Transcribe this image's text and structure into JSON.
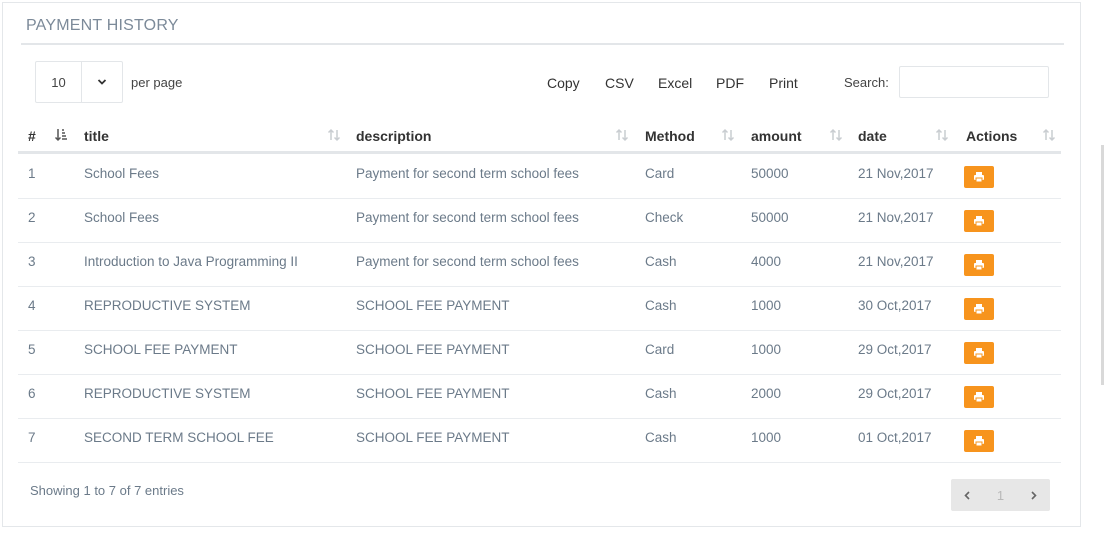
{
  "panel": {
    "title": "PAYMENT HISTORY"
  },
  "length": {
    "value": "10",
    "suffix": "per page"
  },
  "buttons": [
    "Copy",
    "CSV",
    "Excel",
    "PDF",
    "Print"
  ],
  "search": {
    "label": "Search:",
    "value": ""
  },
  "columns": [
    "#",
    "title",
    "description",
    "Method",
    "amount",
    "date",
    "Actions"
  ],
  "rows": [
    {
      "n": "1",
      "title": "School Fees",
      "description": "Payment for second term school fees",
      "method": "Card",
      "amount": "50000",
      "date": "21 Nov,2017"
    },
    {
      "n": "2",
      "title": "School Fees",
      "description": "Payment for second term school fees",
      "method": "Check",
      "amount": "50000",
      "date": "21 Nov,2017"
    },
    {
      "n": "3",
      "title": "Introduction to Java Programming II",
      "description": "Payment for second term school fees",
      "method": "Cash",
      "amount": "4000",
      "date": "21 Nov,2017"
    },
    {
      "n": "4",
      "title": "REPRODUCTIVE SYSTEM",
      "description": "SCHOOL FEE PAYMENT",
      "method": "Cash",
      "amount": "1000",
      "date": "30 Oct,2017"
    },
    {
      "n": "5",
      "title": "SCHOOL FEE PAYMENT",
      "description": "SCHOOL FEE PAYMENT",
      "method": "Card",
      "amount": "1000",
      "date": "29 Oct,2017"
    },
    {
      "n": "6",
      "title": "REPRODUCTIVE SYSTEM",
      "description": "SCHOOL FEE PAYMENT",
      "method": "Cash",
      "amount": "2000",
      "date": "29 Oct,2017"
    },
    {
      "n": "7",
      "title": "SECOND TERM SCHOOL FEE",
      "description": "SCHOOL FEE PAYMENT",
      "method": "Cash",
      "amount": "1000",
      "date": "01 Oct,2017"
    }
  ],
  "info": "Showing 1 to 7 of 7 entries",
  "pagination": {
    "current": "1"
  },
  "colors": {
    "accent": "#f7941d",
    "text": "#6b7a89",
    "border": "#e3e6e9"
  },
  "icons": {
    "action": "print-icon",
    "length_caret": "chevron-down-icon",
    "sort": "sort-icon"
  }
}
